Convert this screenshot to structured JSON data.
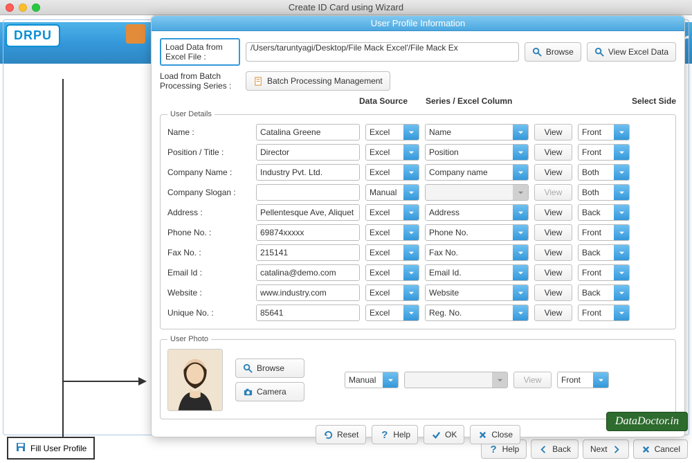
{
  "window": {
    "title": "Create ID Card using Wizard"
  },
  "logo": "DRPU",
  "panel": {
    "title": "User Profile Information",
    "load_excel_label": "Load Data from Excel File :",
    "path": "/Users/taruntyagi/Desktop/File Mack  Excel'/File Mack  Ex",
    "browse": "Browse",
    "view_excel": "View Excel Data",
    "batch_label": "Load from Batch Processing Series :",
    "batch_btn": "Batch Processing Management",
    "legend_details": "User Details",
    "legend_photo": "User Photo",
    "headers": {
      "ds": "Data Source",
      "sec": "Series / Excel Column",
      "side": "Select Side"
    },
    "view": "View",
    "rows": [
      {
        "label": "Name :",
        "value": "Catalina Greene",
        "ds": "Excel",
        "col": "Name",
        "view": true,
        "side": "Front"
      },
      {
        "label": "Position / Title :",
        "value": "Director",
        "ds": "Excel",
        "col": "Position",
        "view": true,
        "side": "Front"
      },
      {
        "label": "Company Name :",
        "value": "Industry Pvt. Ltd.",
        "ds": "Excel",
        "col": "Company name",
        "view": true,
        "side": "Both"
      },
      {
        "label": "Company Slogan :",
        "value": "",
        "ds": "Manual",
        "col": "",
        "view": false,
        "side": "Both"
      },
      {
        "label": "Address :",
        "value": "Pellentesque Ave, Aliquet",
        "ds": "Excel",
        "col": "Address",
        "view": true,
        "side": "Back"
      },
      {
        "label": "Phone No. :",
        "value": "69874xxxxx",
        "ds": "Excel",
        "col": "Phone No.",
        "view": true,
        "side": "Front"
      },
      {
        "label": "Fax No. :",
        "value": "215141",
        "ds": "Excel",
        "col": "Fax No.",
        "view": true,
        "side": "Back"
      },
      {
        "label": "Email Id :",
        "value": "catalina@demo.com",
        "ds": "Excel",
        "col": "Email Id.",
        "view": true,
        "side": "Front"
      },
      {
        "label": "Website :",
        "value": "www.industry.com",
        "ds": "Excel",
        "col": "Website",
        "view": true,
        "side": "Back"
      },
      {
        "label": "Unique No. :",
        "value": "85641",
        "ds": "Excel",
        "col": "Reg. No.",
        "view": true,
        "side": "Front"
      }
    ],
    "photo": {
      "browse": "Browse",
      "camera": "Camera",
      "ds": "Manual",
      "col": "",
      "view": false,
      "side": "Front"
    },
    "buttons": {
      "reset": "Reset",
      "help": "Help",
      "ok": "OK",
      "close": "Close"
    }
  },
  "footer": {
    "help": "Help",
    "back": "Back",
    "next": "Next",
    "cancel": "Cancel"
  },
  "annotation": "Fill User Profile",
  "watermark": "DataDoctor.in"
}
